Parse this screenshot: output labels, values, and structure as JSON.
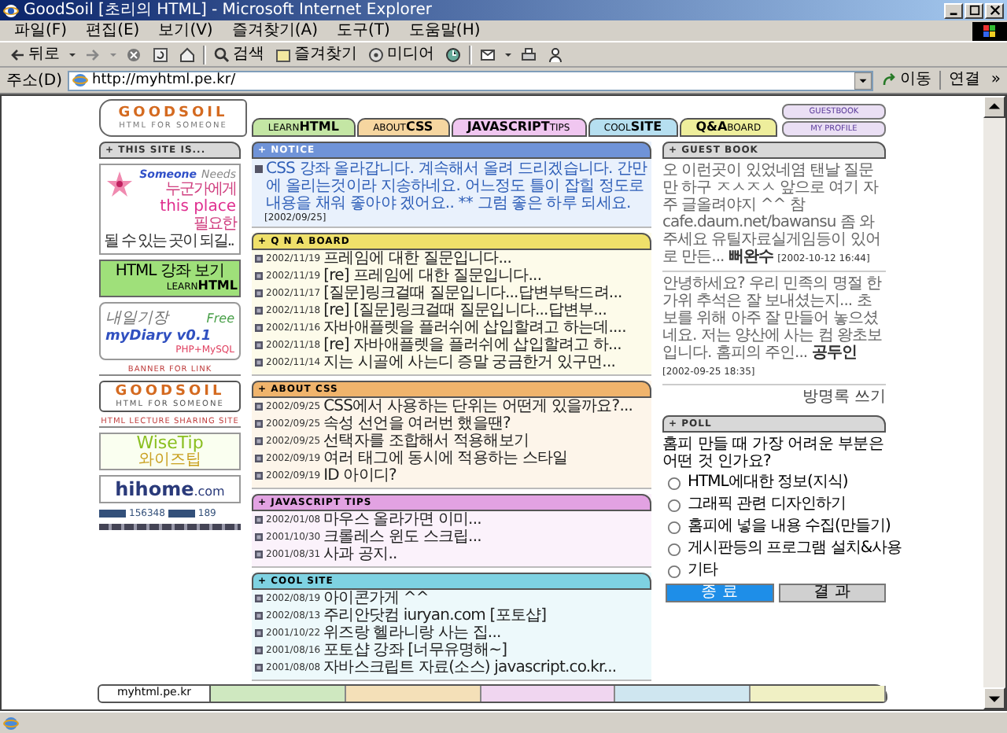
{
  "window": {
    "title": "GoodSoil [초리의 HTML] - Microsoft Internet Explorer"
  },
  "menu": [
    "파일(F)",
    "편집(E)",
    "보기(V)",
    "즐겨찾기(A)",
    "도구(T)",
    "도움말(H)"
  ],
  "toolbar": {
    "back": "뒤로",
    "search": "검색",
    "favorites": "즐겨찾기",
    "media": "미디어"
  },
  "address_bar": {
    "label": "주소(D)",
    "url": "http://myhtml.pe.kr/",
    "go": "이동",
    "links": "연결",
    "more": "»"
  },
  "header": {
    "logo": {
      "title": "GOODSOIL",
      "subtitle": "HTML FOR SOMEONE"
    },
    "nav": [
      {
        "label": "LEARN**HTML**",
        "color": "#c4e6a4"
      },
      {
        "label": "ABOUT**CSS**",
        "color": "#f6d6a0"
      },
      {
        "label": "**JAVASCRIPT**TIPS",
        "color": "#f0c6f0"
      },
      {
        "label": "COOL**SITE**",
        "color": "#b6dff0"
      },
      {
        "label": "**Q&A**BOARD",
        "color": "#eeee9c"
      }
    ],
    "side_links": [
      "GUESTBOOK",
      "MY PROFILE"
    ]
  },
  "left": {
    "header": "+ THIS SITE IS...",
    "someone_banner": {
      "title": "Someone",
      "needs": "Needs",
      "line_1": "누군가에게",
      "place": "this place",
      "line_2": "필요한",
      "line_3": "될 수 있는 곳이 되길.."
    },
    "learn_button": {
      "title": "HTML 강좌 보기",
      "label": "LEARN**HTML**"
    },
    "diary_banner": {
      "title": "내일기장",
      "free": "Free",
      "name": "myDiary v0.1",
      "tech": "PHP+MySQL"
    },
    "link_label": "BANNER FOR LINK",
    "goodsoil_banner": {
      "title": "GOODSOIL",
      "subtitle": "HTML FOR SOMEONE"
    },
    "lecture_label": "HTML LECTURE SHARING SITE",
    "wisetip_banner": {
      "title": "WiseTip",
      "subtitle": "와이즈팁"
    },
    "hihome_banner": {
      "title": "hihome",
      "suffix": ".com"
    },
    "counter": {
      "total": "156348",
      "today": "189"
    }
  },
  "notice": {
    "header": "+ NOTICE",
    "text": "CSS 강좌 올라갑니다. 계속해서 올려 드리겠습니다. 간만에 올리는것이라 지송하네요. 어느정도 틀이 잡힐 정도로 내용을 채워 좋아야 겠어요.. ** 그럼 좋은 하루 되세요.",
    "date": "[2002/09/25]"
  },
  "sections": [
    {
      "header": "+ Q N A BOARD",
      "color": "#efe06a",
      "items": [
        {
          "date": "2002/11/19",
          "title": "프레임에 대한 질문입니다..."
        },
        {
          "date": "2002/11/19",
          "title": "[re] 프레임에 대한 질문입니다..."
        },
        {
          "date": "2002/11/17",
          "title": "[질문]링크걸때 질문입니다...답변부탁드려..."
        },
        {
          "date": "2002/11/18",
          "title": "[re] [질문]링크걸때 질문입니다...답변부..."
        },
        {
          "date": "2002/11/16",
          "title": "자바애플렛을 플러쉬에 삽입할려고 하는데...."
        },
        {
          "date": "2002/11/18",
          "title": "[re] 자바애플렛을 플러쉬에 삽입할려고 하..."
        },
        {
          "date": "2002/11/14",
          "title": "지는 시골에 사는디 증말 궁금한거 있구먼..."
        }
      ]
    },
    {
      "header": "+ ABOUT CSS",
      "color": "#f0b46c",
      "items": [
        {
          "date": "2002/09/25",
          "title": "CSS에서 사용하는 단위는 어떤게 있을까요?..."
        },
        {
          "date": "2002/09/25",
          "title": "속성 선언을 여러번 했을땐?"
        },
        {
          "date": "2002/09/25",
          "title": "선택자를 조합해서 적용해보기"
        },
        {
          "date": "2002/09/19",
          "title": "여러 태그에 동시에 적용하는 스타일"
        },
        {
          "date": "2002/09/19",
          "title": "ID 아이디?"
        }
      ]
    },
    {
      "header": "+ JAVASCRIPT TIPS",
      "color": "#e2a2e2",
      "items": [
        {
          "date": "2002/01/08",
          "title": "마우스 올라가면 이미..."
        },
        {
          "date": "2001/10/30",
          "title": "크롤레스 윈도 스크립..."
        },
        {
          "date": "2001/08/31",
          "title": "사과 공지.."
        }
      ]
    },
    {
      "header": "+ COOL SITE",
      "color": "#7ed2e2",
      "items": [
        {
          "date": "2002/08/19",
          "title": "아이콘가게 ^^"
        },
        {
          "date": "2002/08/13",
          "title": "주리안닷컴 iuryan.com [포토샵]"
        },
        {
          "date": "2001/10/22",
          "title": "위즈랑 헬라니랑 사는 집..."
        },
        {
          "date": "2001/08/16",
          "title": "포토샵 강좌 [너무유명해~]"
        },
        {
          "date": "2001/08/08",
          "title": "자바스크립트 자료(소스) javascript.co.kr..."
        }
      ]
    }
  ],
  "guestbook": {
    "header": "+ GUEST BOOK",
    "entries": [
      {
        "text": "오 이런곳이 있었네염 탠날 질문만 하구 ㅈㅅㅈㅅ 앞으로 여기 자주 글올려야지 ^^ 참cafe.daum.net/bawansu 좀 와주세요 유틸자료실게임등이 있어로 만든...",
        "author": "뻐완수",
        "date": "[2002-10-12 16:44]"
      },
      {
        "text": "안녕하세요? 우리 민족의 명절 한가위 추석은 잘 보내셨는지... 초보를 위해 아주 잘 만들어 놓으셨네요. 저는 양산에 사는 컴 왕초보 입니다. 홈피의 주인...",
        "author": "공두인",
        "date": "[2002-09-25 18:35]"
      }
    ],
    "write_link": "방명록 쓰기"
  },
  "poll": {
    "header": "+ POLL",
    "question": "홈피 만들 때 가장 어려운 부분은 어떤 것 인가요?",
    "options": [
      {
        "label": "HTML에대한 정보(지식)",
        "selected": false
      },
      {
        "label": "그래픽 관련 디자인하기",
        "selected": false
      },
      {
        "label": "홈피에 넣을 내용 수집(만들기)",
        "selected": false
      },
      {
        "label": "게시판등의 프로그램 설치&사용",
        "selected": false
      },
      {
        "label": "기타",
        "selected": false
      }
    ],
    "buttons": [
      "종 료",
      "결 과"
    ]
  },
  "footer": {
    "label": "myhtml.pe.kr"
  }
}
